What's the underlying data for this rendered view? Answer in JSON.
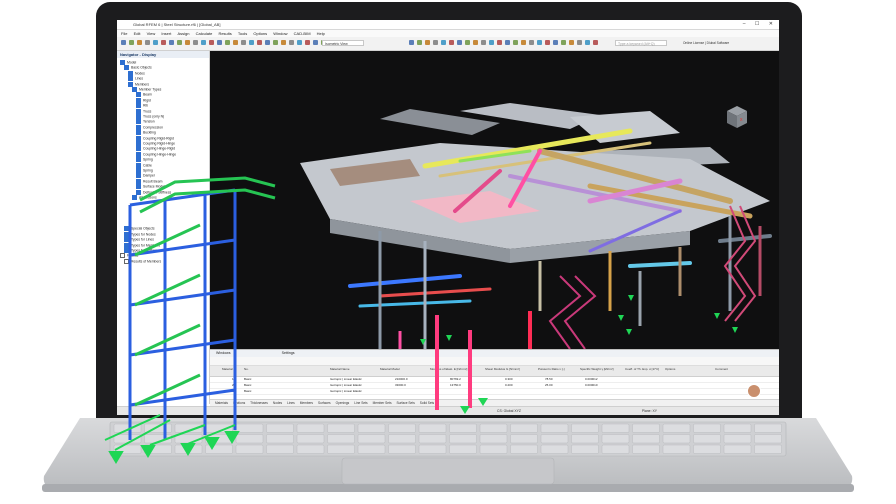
{
  "app": {
    "title": "Global RFEM 6 | Steel Structure.rf6 | [Global_AB]",
    "license": "Online License | Dlubal Software",
    "search_placeholder": "Type a keyword (Alt+Q)",
    "view_combo": "Isometric View",
    "window_controls": "– ☐ ✕"
  },
  "menu": [
    "File",
    "Edit",
    "View",
    "Insert",
    "Assign",
    "Calculate",
    "Results",
    "Tools",
    "Options",
    "Window",
    "CAD-BIM",
    "Help"
  ],
  "navigator": {
    "header": "Navigator - Display",
    "items": [
      {
        "label": "Model",
        "level": 0,
        "checked": true
      },
      {
        "label": "Basic Objects",
        "level": 1,
        "checked": true
      },
      {
        "label": "Nodes",
        "level": 2,
        "checked": true
      },
      {
        "label": "Lines",
        "level": 2,
        "checked": true
      },
      {
        "label": "Members",
        "level": 2,
        "checked": true
      },
      {
        "label": "Member Types",
        "level": 3,
        "checked": true
      },
      {
        "label": "Beam",
        "level": 4,
        "checked": true
      },
      {
        "label": "Rigid",
        "level": 4,
        "checked": true
      },
      {
        "label": "Rib",
        "level": 4,
        "checked": true
      },
      {
        "label": "Truss",
        "level": 4,
        "checked": true
      },
      {
        "label": "Truss (only N)",
        "level": 4,
        "checked": true
      },
      {
        "label": "Tension",
        "level": 4,
        "checked": true
      },
      {
        "label": "Compression",
        "level": 4,
        "checked": true
      },
      {
        "label": "Buckling",
        "level": 4,
        "checked": true
      },
      {
        "label": "Coupling Rigid-Rigid",
        "level": 4,
        "checked": true
      },
      {
        "label": "Coupling Rigid-Hinge",
        "level": 4,
        "checked": true
      },
      {
        "label": "Coupling Hinge-Rigid",
        "level": 4,
        "checked": true
      },
      {
        "label": "Coupling Hinge-Hinge",
        "level": 4,
        "checked": true
      },
      {
        "label": "Spring",
        "level": 4,
        "checked": true
      },
      {
        "label": "Cable",
        "level": 4,
        "checked": true
      },
      {
        "label": "Spring",
        "level": 4,
        "checked": true
      },
      {
        "label": "Damper",
        "level": 4,
        "checked": true
      },
      {
        "label": "Result Beam",
        "level": 4,
        "checked": true
      },
      {
        "label": "Surface Model",
        "level": 4,
        "checked": true
      },
      {
        "label": "Definable Stiffness",
        "level": 4,
        "checked": true
      },
      {
        "label": "All Sections",
        "level": 3,
        "checked": true
      }
    ],
    "lower_items": [
      {
        "label": "Special Objects",
        "level": 1,
        "checked": true
      },
      {
        "label": "Types for Nodes",
        "level": 1,
        "checked": true
      },
      {
        "label": "Types for Lines",
        "level": 1,
        "checked": true
      },
      {
        "label": "Types for Members",
        "level": 1,
        "checked": true
      },
      {
        "label": "Types for Surfaces",
        "level": 1,
        "checked": true
      },
      {
        "label": "Results",
        "level": 0,
        "checked": false
      },
      {
        "label": "Results of Members",
        "level": 1,
        "checked": false
      }
    ]
  },
  "panel": {
    "title": "Windows",
    "settings": "Settings",
    "columns": [
      "Material",
      "No.",
      "Material Name",
      "Material Model",
      "Modulus of Elast. E [N/mm²]",
      "Shear Modulus G [N/mm²]",
      "Poisson's Ratio v [-]",
      "Specific Weight γ [kN/m³]",
      "Coeff. of Th. Exp. α [1/°C]",
      "Options",
      "Comment"
    ],
    "rows": [
      [
        "1",
        "Basic",
        "Isotropic | Linear Elastic",
        "210000.0",
        "80769.2",
        "0.300",
        "78.50",
        "0.000012"
      ],
      [
        "2",
        "Basic",
        "Isotropic | Linear Elastic",
        "33000.0",
        "13750.0",
        "0.200",
        "25.00",
        "0.000010"
      ],
      [
        "3",
        "Basic",
        "Isotropic | Linear Elastic",
        "",
        "",
        "",
        "",
        ""
      ]
    ],
    "tabs": [
      "Materials",
      "Sections",
      "Thicknesses",
      "Nodes",
      "Lines",
      "Members",
      "Surfaces",
      "Openings",
      "Line Sets",
      "Member Sets",
      "Surface Sets",
      "Solid Sets"
    ]
  },
  "statusbar": {
    "left": "CS: Global XYZ",
    "right": "Plane: XY"
  },
  "colors": {
    "viewport_bg": "#0f0f10",
    "support_green": "#1fd655",
    "tower_blue": "#2b5fe0",
    "laptop_body": "#1c1c1e"
  }
}
